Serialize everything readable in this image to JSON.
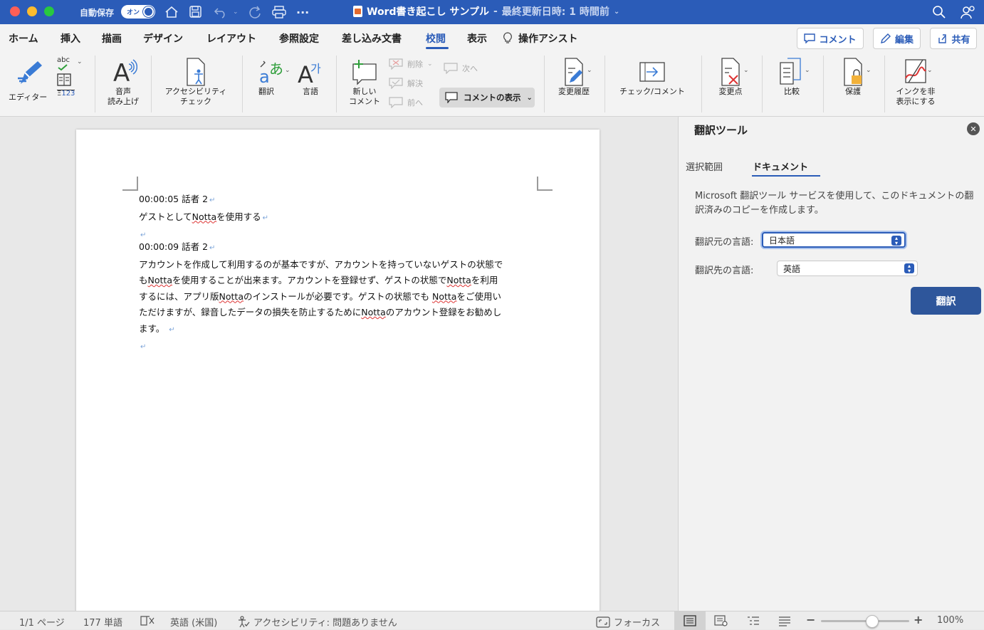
{
  "titlebar": {
    "autosave_label": "自動保存",
    "autosave_state": "オン",
    "doc_name": "Word書き起こし サンプル",
    "separator": "-",
    "last_saved": "最終更新日時: 1 時間前"
  },
  "menu": {
    "tabs": [
      "ホーム",
      "挿入",
      "描画",
      "デザイン",
      "レイアウト",
      "参照設定",
      "差し込み文書",
      "校閲",
      "表示"
    ],
    "active_tab": "校閲",
    "tell_me": "操作アシスト",
    "comments_btn": "コメント",
    "edit_btn": "編集",
    "share_btn": "共有"
  },
  "ribbon": {
    "editor": "エディター",
    "abc": "abc",
    "wordcount": "123",
    "read_aloud_1": "音声",
    "read_aloud_2": "読み上げ",
    "a11y_1": "アクセシビリティ",
    "a11y_2": "チェック",
    "translate": "翻訳",
    "language": "言語",
    "new_comment_1": "新しい",
    "new_comment_2": "コメント",
    "delete": "削除",
    "resolve": "解決",
    "previous": "前へ",
    "next": "次へ",
    "show_comments": "コメントの表示",
    "track_changes": "変更履歴",
    "check_comment": "チェック/コメント",
    "changes": "変更点",
    "compare": "比較",
    "protect": "保護",
    "hide_ink_1": "インクを非",
    "hide_ink_2": "表示にする"
  },
  "document": {
    "p1_head": "00:00:05 話者 2",
    "p1_body_a": "ゲストとして",
    "p1_body_b": "Notta",
    "p1_body_c": "を使用する",
    "p2_head": "00:00:09 話者 2",
    "p2_l1": "アカウントを作成して利用するのが基本ですが、アカウントを持っていないゲストの状態で",
    "p2_l2a": "も",
    "p2_l2b": "Notta",
    "p2_l2c": "を使用することが出来ます。アカウントを登録せず、ゲストの状態で",
    "p2_l2d": "Notta",
    "p2_l2e": "を利用",
    "p2_l3a": "するには、アプリ版",
    "p2_l3b": "Notta",
    "p2_l3c": "のインストールが必要です。ゲストの状態でも ",
    "p2_l3d": "Notta",
    "p2_l3e": "をご使用い",
    "p2_l4a": "ただけますが、録音したデータの損失を防止するために",
    "p2_l4b": "Notta",
    "p2_l4c": "のアカウント登録をお勧めし",
    "p2_l5": "ます。",
    "para_mark": "↵"
  },
  "pane": {
    "title": "翻訳ツール",
    "tab_selection": "選択範囲",
    "tab_document": "ドキュメント",
    "description": "Microsoft 翻訳ツール サービスを使用して、このドキュメントの翻訳済みのコピーを作成します。",
    "from_label": "翻訳元の言語:",
    "from_value": "日本語",
    "to_label": "翻訳先の言語:",
    "to_value": "英語",
    "translate_button": "翻訳"
  },
  "statusbar": {
    "page": "1/1 ページ",
    "words": "177 単語",
    "language": "英語 (米国)",
    "accessibility": "アクセシビリティ: 問題ありません",
    "focus": "フォーカス",
    "zoom": "100%",
    "zoom_level": 0.58
  },
  "colors": {
    "brand": "#2b5cb8",
    "translate_btn": "#2e569b",
    "squiggle": "#d33333"
  }
}
